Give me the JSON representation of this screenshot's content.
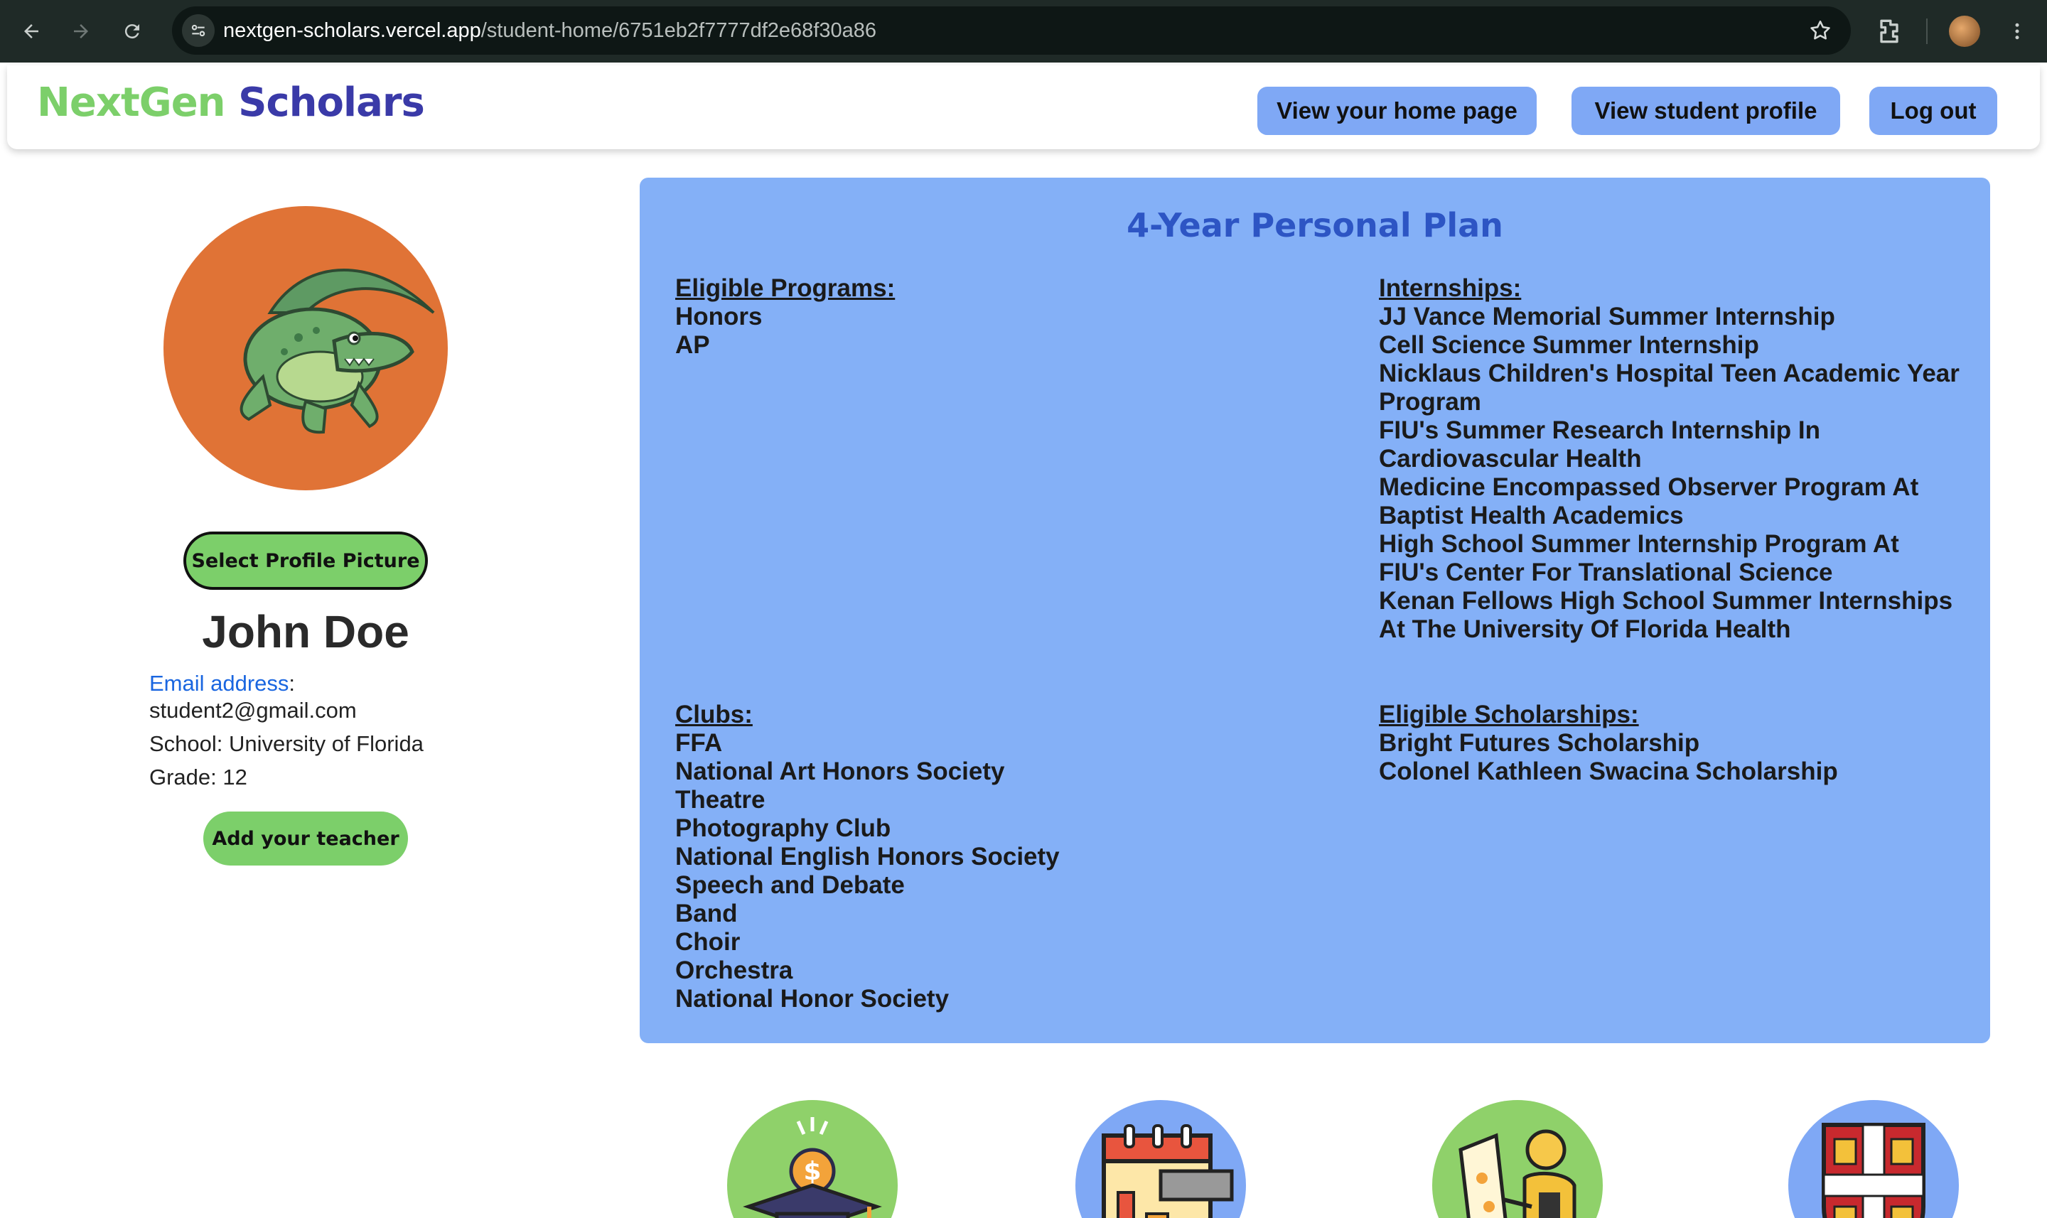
{
  "browser": {
    "url_host": "nextgen-scholars.vercel.app",
    "url_path": "/student-home/6751eb2f7777df2e68f30a86"
  },
  "header": {
    "logo_part1": "NextGen",
    "logo_part2": "Scholars",
    "buttons": {
      "home": "View your home page",
      "profile": "View student profile",
      "logout": "Log out"
    }
  },
  "profile": {
    "select_picture_label": "Select Profile Picture",
    "name": "John Doe",
    "email_label": "Email address",
    "email_value": "student2@gmail.com",
    "school": "School: University of Florida",
    "grade": "Grade: 12",
    "add_teacher_label": "Add your teacher"
  },
  "plan": {
    "title": "4-Year Personal Plan",
    "programs": {
      "heading": "Eligible Programs:",
      "items": [
        "Honors",
        "AP"
      ]
    },
    "internships": {
      "heading": "Internships:",
      "items": [
        "JJ Vance Memorial Summer Internship",
        "Cell Science Summer Internship",
        "Nicklaus Children's Hospital Teen Academic Year Program",
        "FIU's Summer Research Internship In Cardiovascular Health",
        "Medicine Encompassed Observer Program At Baptist Health Academics",
        "High School Summer Internship Program At FIU's Center For Translational Science",
        "Kenan Fellows High School Summer Internships At The University Of Florida Health"
      ]
    },
    "clubs": {
      "heading": "Clubs:",
      "items": [
        "FFA",
        "National Art Honors Society",
        "Theatre",
        "Photography Club",
        "National English Honors Society",
        "Speech and Debate",
        "Band",
        "Choir",
        "Orchestra",
        "National Honor Society"
      ]
    },
    "scholarships": {
      "heading": "Eligible Scholarships:",
      "items": [
        "Bright Futures Scholarship",
        "Colonel Kathleen Swacina Scholarship"
      ]
    }
  },
  "colors": {
    "brand_green": "#7ccf6a",
    "brand_blue": "#3a3aa8",
    "button_blue": "#7fa8f5",
    "card_blue": "#84b0f7",
    "avatar_orange": "#e07336"
  },
  "icons": [
    "back-arrow-icon",
    "forward-arrow-icon",
    "reload-icon",
    "site-info-icon",
    "star-icon",
    "extensions-icon",
    "more-menu-icon",
    "alligator-avatar",
    "scholarship-icon",
    "planner-icon",
    "art-icon",
    "university-crest-icon"
  ]
}
